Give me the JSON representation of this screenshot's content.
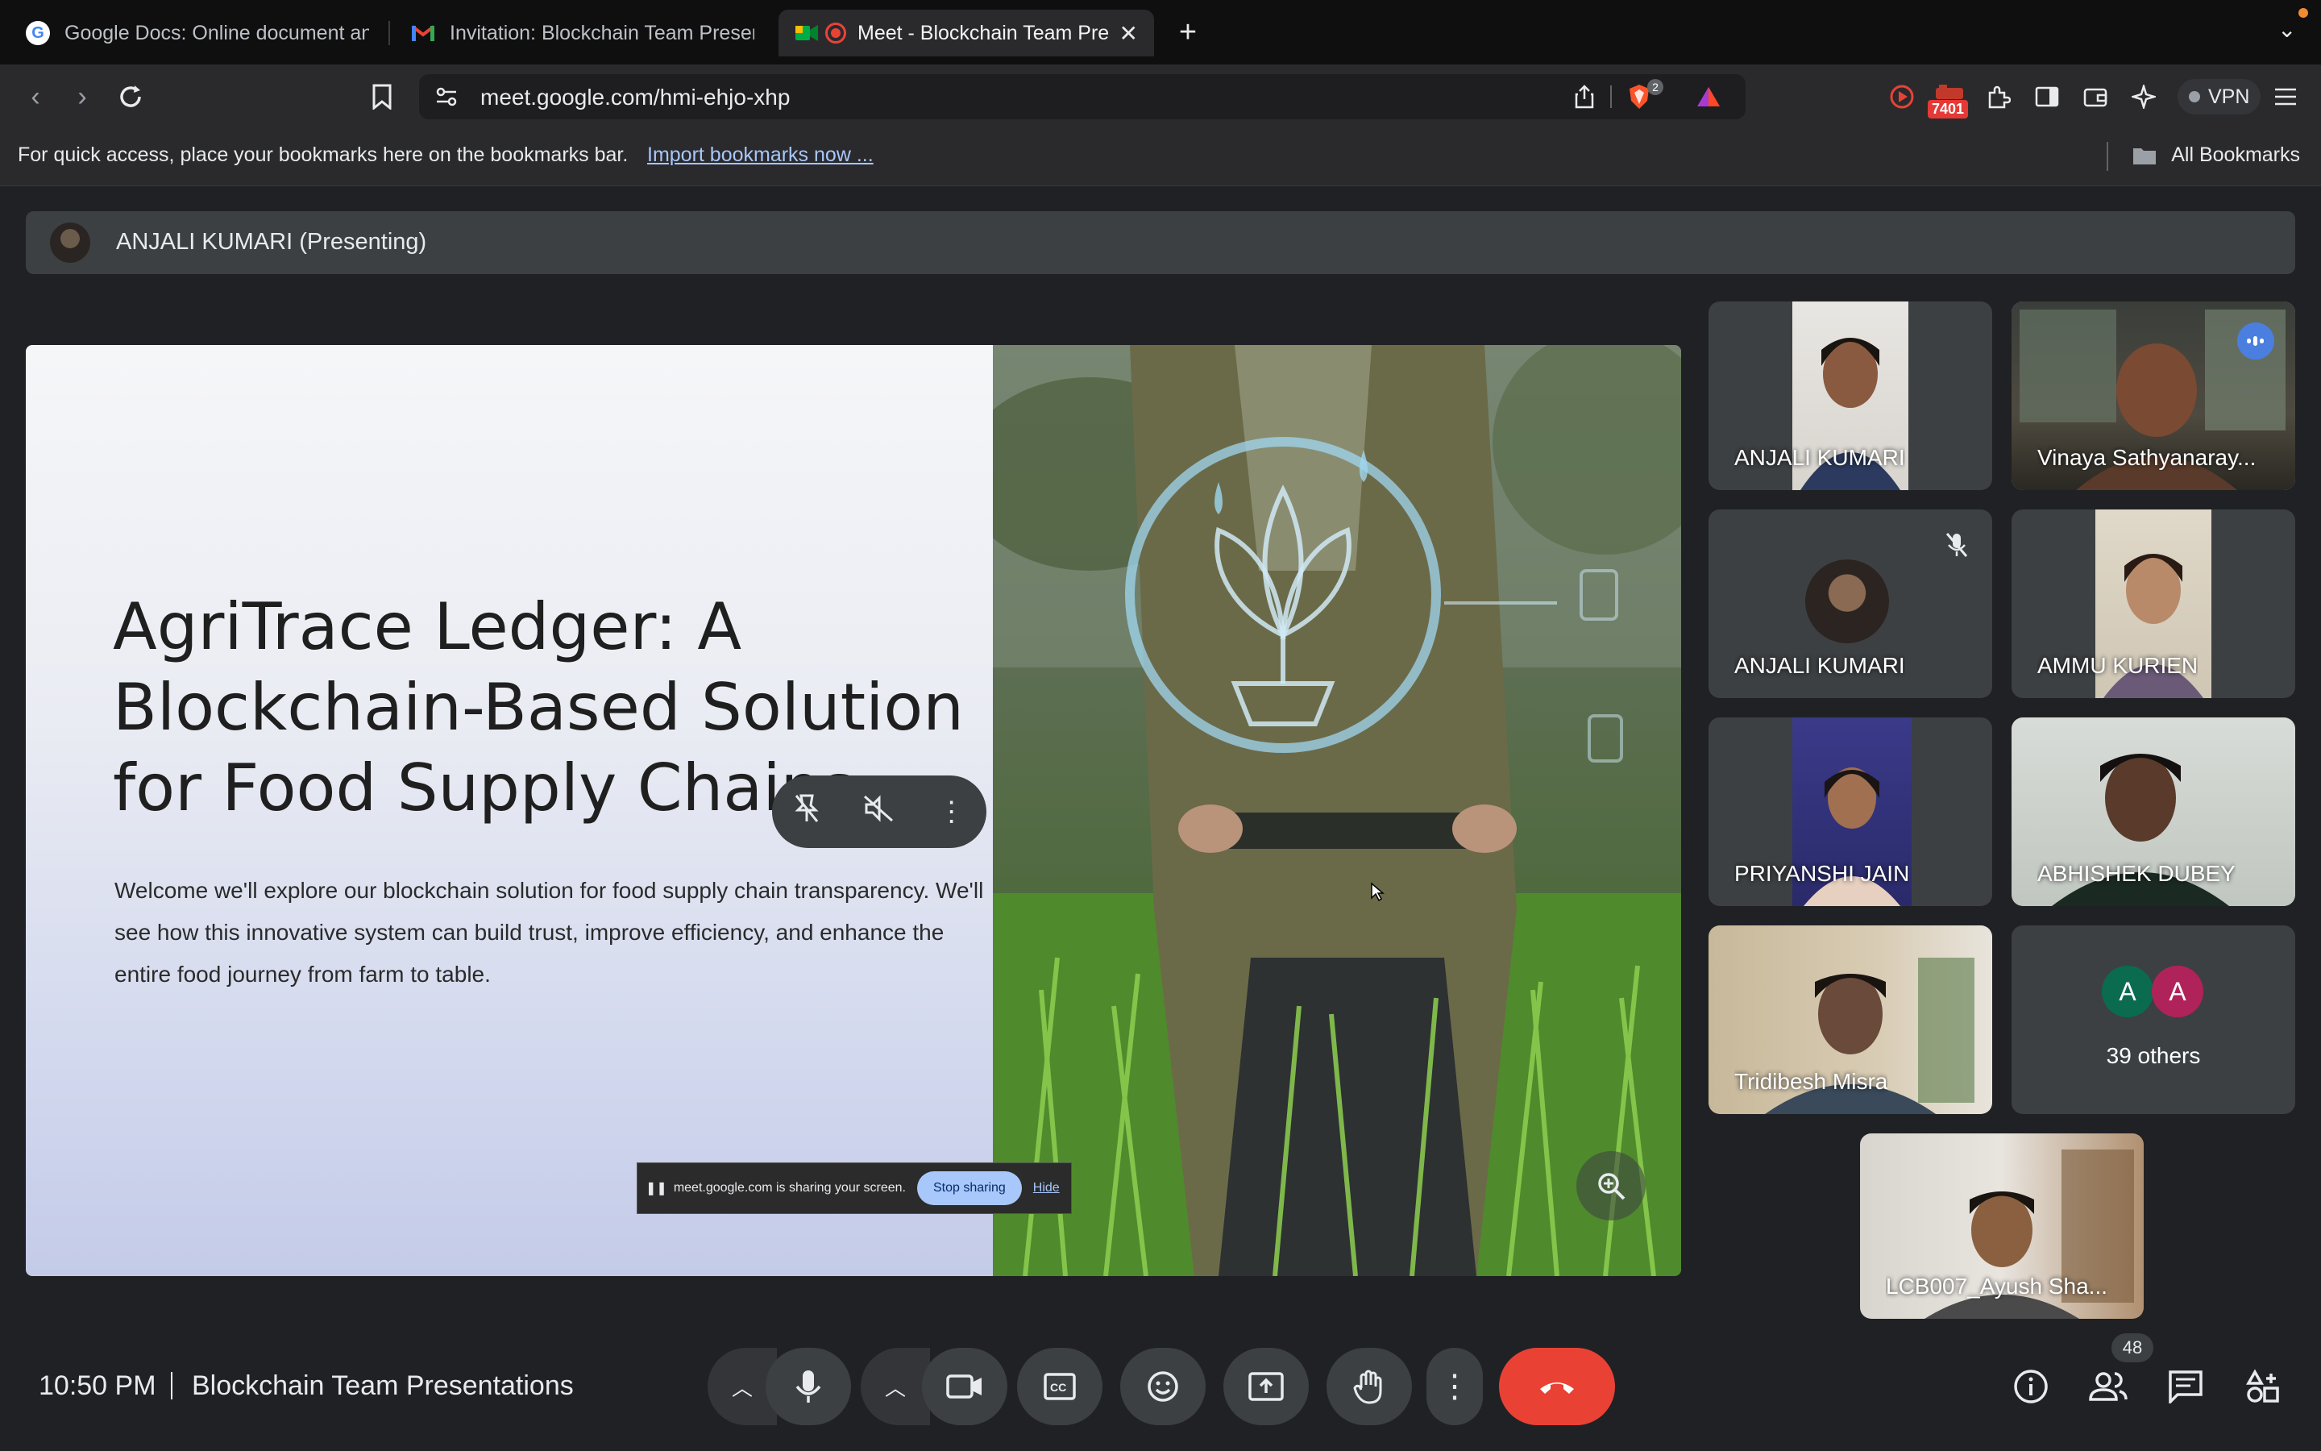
{
  "browser": {
    "tabs": [
      {
        "title": "Google Docs: Online document and",
        "favicon": "google-icon"
      },
      {
        "title": "Invitation: Blockchain Team Presentations",
        "favicon": "gmail-icon"
      },
      {
        "title": "Meet - Blockchain Team Presentations",
        "favicon": "meet-icon",
        "active": true
      }
    ],
    "new_tab": "+",
    "url": "meet.google.com/hmi-ehjo-xhp",
    "brave_badge": "2",
    "extension_badge": "7401",
    "vpn_label": "VPN"
  },
  "bookmarks_bar": {
    "hint": "For quick access, place your bookmarks here on the bookmarks bar.",
    "import_link": "Import bookmarks now ...",
    "all_bookmarks": "All Bookmarks"
  },
  "meet": {
    "presenter_label": "ANJALI KUMARI (Presenting)",
    "slide": {
      "title": "AgriTrace Ledger: A Blockchain-Based Solution for Food Supply Chains",
      "body": "Welcome we'll explore our blockchain solution for food supply chain transparency. We'll see how this innovative system can build trust, improve efficiency, and enhance the entire food journey from farm to table."
    },
    "sharing_notice": {
      "text": "meet.google.com is sharing your screen.",
      "stop_label": "Stop sharing",
      "hide_label": "Hide"
    },
    "participants": [
      {
        "name": "ANJALI KUMARI"
      },
      {
        "name": "Vinaya Sathyanaray..."
      },
      {
        "name": "ANJALI KUMARI"
      },
      {
        "name": "AMMU KURIEN"
      },
      {
        "name": "PRIYANSHI JAIN"
      },
      {
        "name": "ABHISHEK DUBEY"
      },
      {
        "name": "Tridibesh Misra"
      },
      {
        "name": "LCB007_Ayush Sha..."
      }
    ],
    "others": {
      "avatar1": "A",
      "avatar2": "A",
      "label": "39 others"
    },
    "clock": "10:50 PM",
    "meeting_title": "Blockchain Team Presentations",
    "people_count": "48",
    "colors": {
      "end_call": "#e94235",
      "speaking_border": "#8ab4f8",
      "avatar_green": "#0b6b4f",
      "avatar_pink": "#b0235a"
    }
  }
}
